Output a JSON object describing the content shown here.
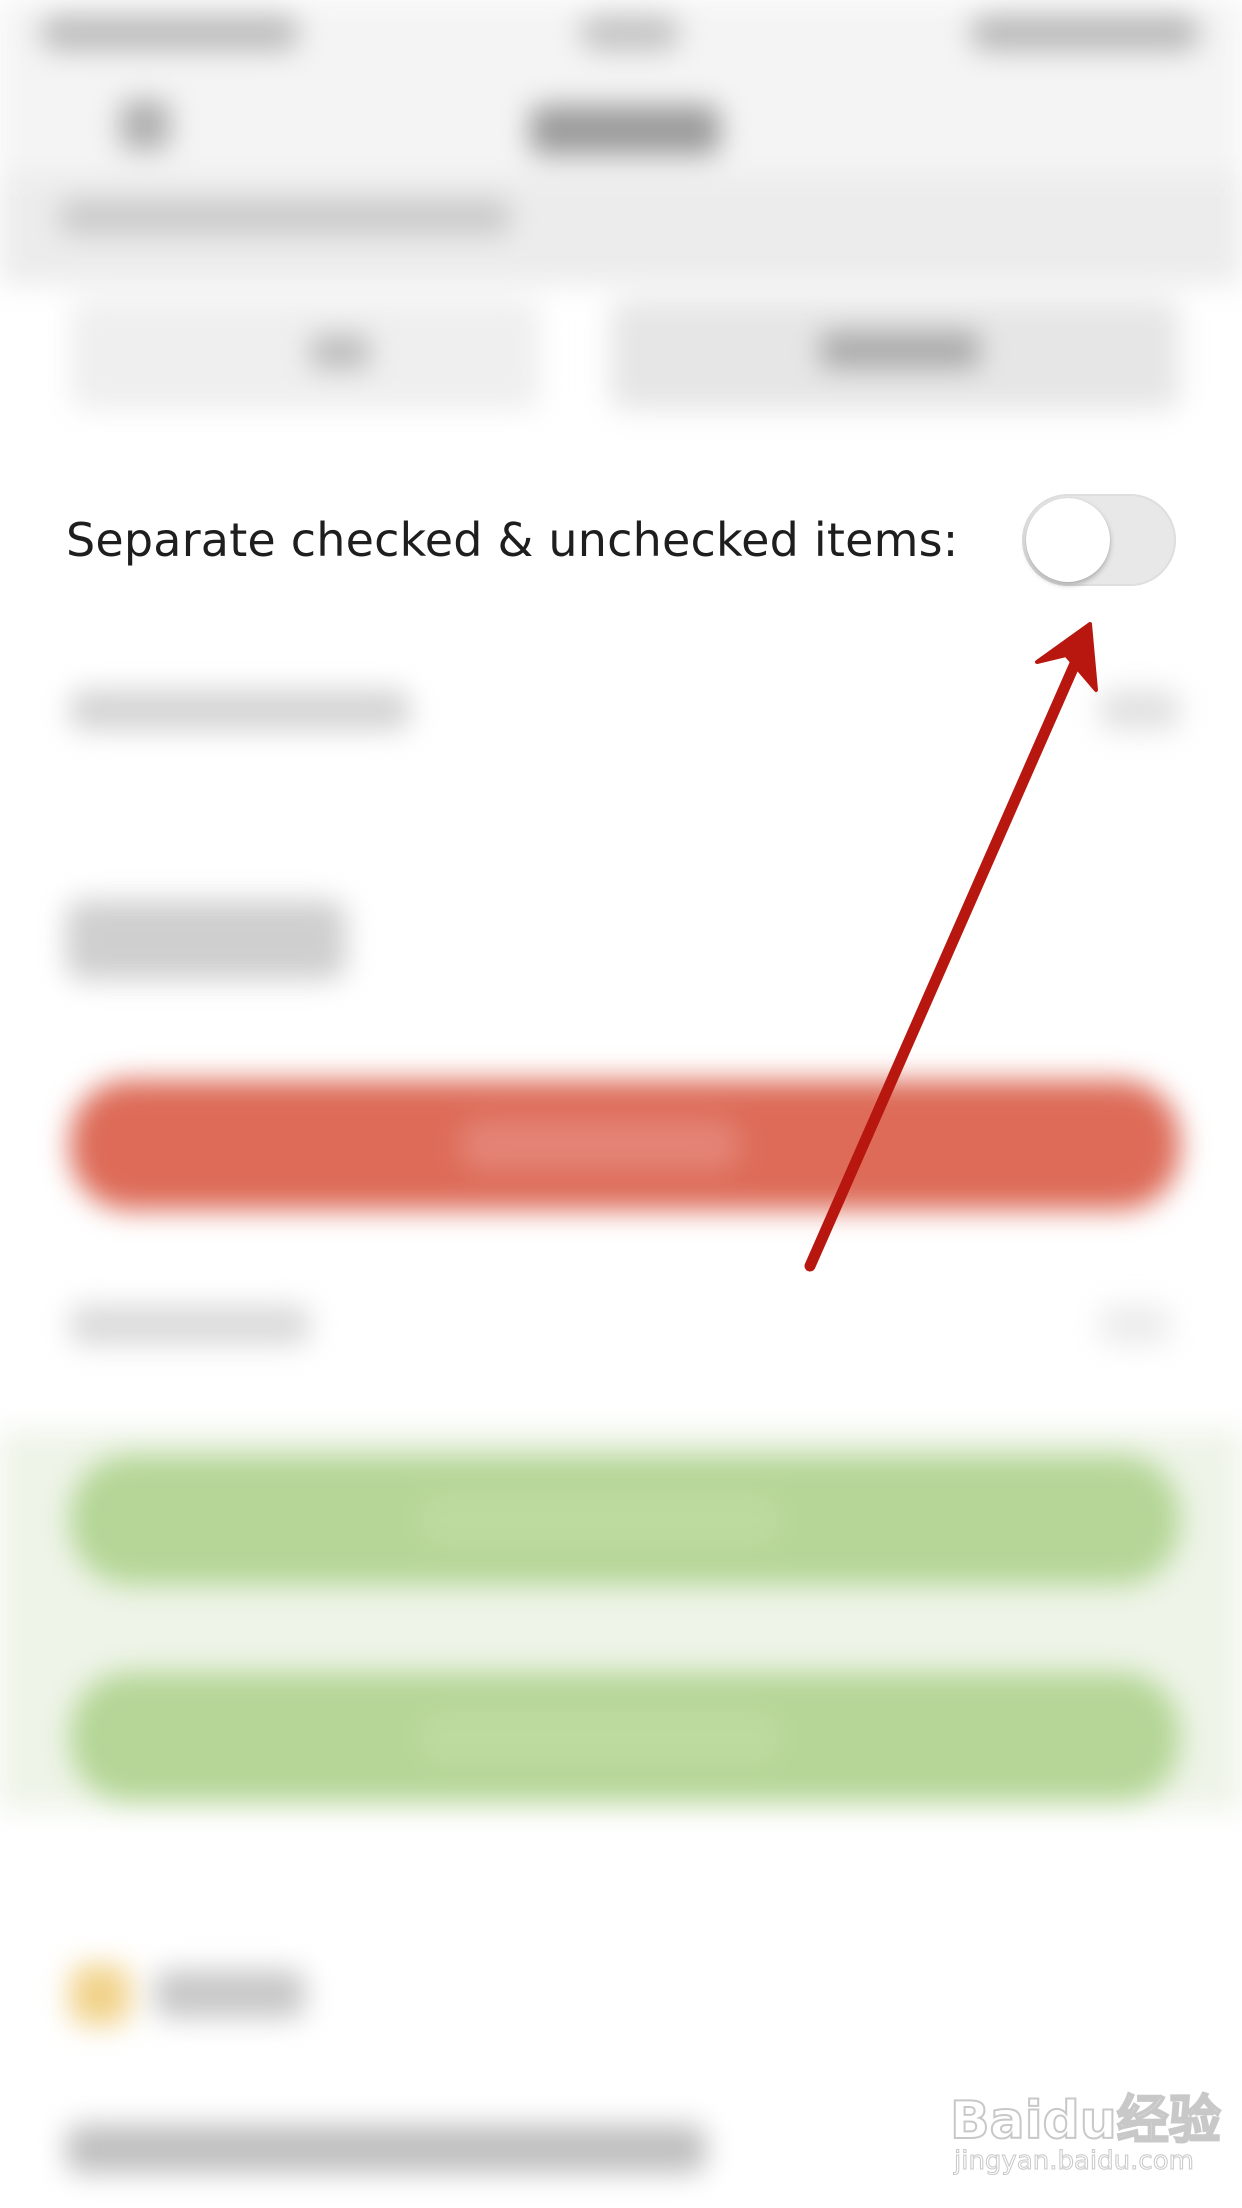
{
  "setting": {
    "label": "Separate checked & unchecked items:",
    "toggle_on": false
  },
  "colors": {
    "toggle_track_off": "#e8e8e8",
    "red_button": "#dd6b58",
    "green_button": "#b5d697",
    "annotation_arrow": "#b8170f",
    "icon_yellow": "#f1d28a"
  },
  "icons": {
    "annotation": "arrow-up-right-icon",
    "section_icon": "yellow-square-icon"
  },
  "watermark": {
    "logo": "Baidu经验",
    "sub": "jingyan.baidu.com"
  }
}
